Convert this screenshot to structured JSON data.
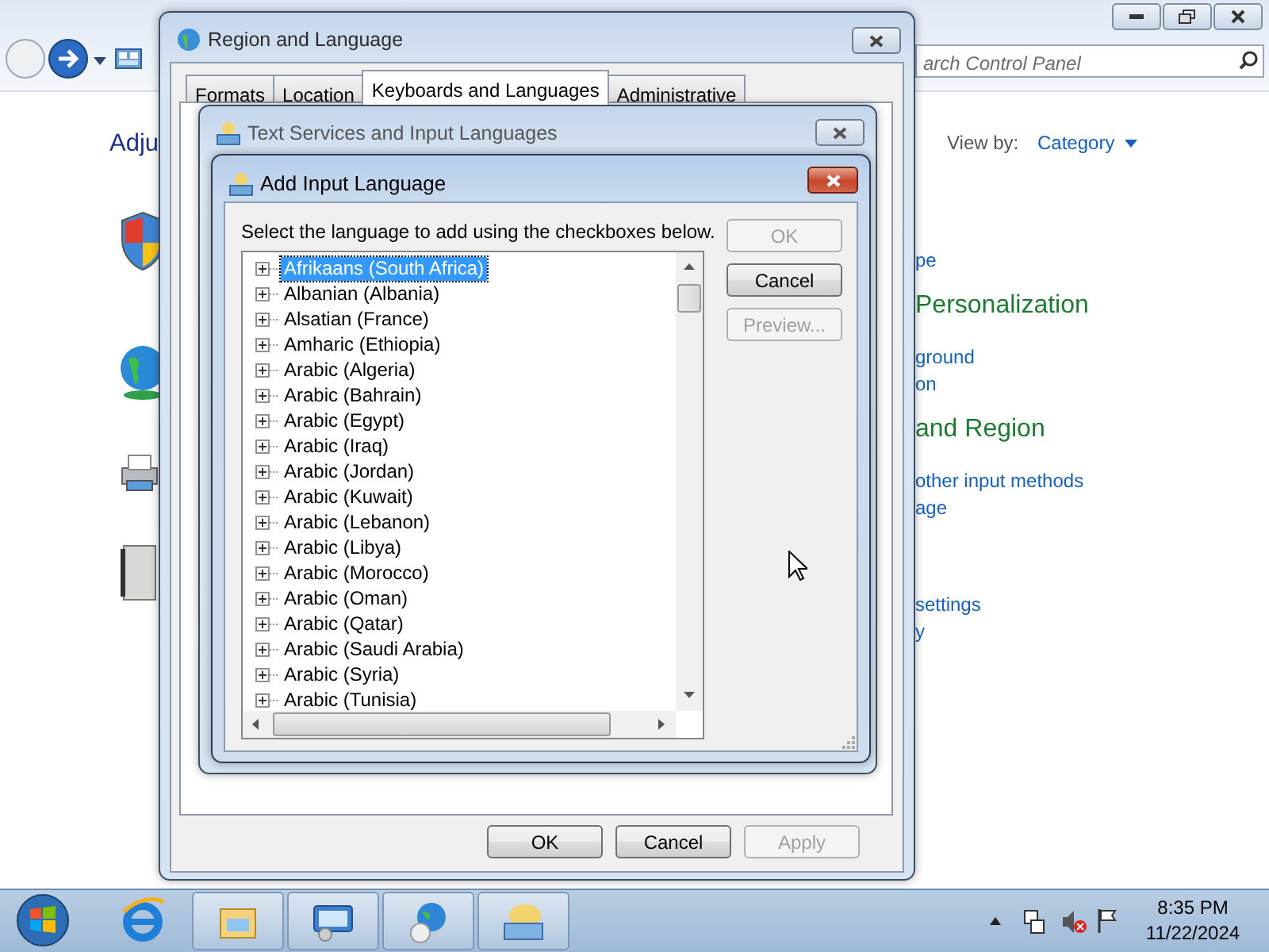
{
  "control_panel": {
    "search": {
      "placeholder": "arch Control Panel"
    },
    "heading": "Adju",
    "view_by_label": "View by:",
    "view_by_value": "Category",
    "groups": [
      {
        "links": [
          "pe"
        ]
      },
      {
        "title": "Personalization",
        "links": [
          "ground",
          "on"
        ]
      },
      {
        "title": "and Region",
        "links": [
          "other input methods",
          "age"
        ]
      },
      {
        "links": [
          "settings",
          "y"
        ]
      }
    ]
  },
  "region_dialog": {
    "title": "Region and Language",
    "tabs": [
      {
        "label": "Formats",
        "selected": false
      },
      {
        "label": "Location",
        "selected": false
      },
      {
        "label": "Keyboards and Languages",
        "selected": true
      },
      {
        "label": "Administrative",
        "selected": false
      }
    ],
    "buttons": [
      {
        "label": "OK",
        "disabled": false
      },
      {
        "label": "Cancel",
        "disabled": false
      },
      {
        "label": "Apply",
        "disabled": true
      }
    ]
  },
  "text_services_dialog": {
    "title": "Text Services and Input Languages"
  },
  "add_language_dialog": {
    "title": "Add Input Language",
    "instruction": "Select the language to add using the checkboxes below.",
    "buttons": [
      {
        "label": "OK",
        "disabled": true
      },
      {
        "label": "Cancel",
        "disabled": false
      },
      {
        "label": "Preview...",
        "disabled": true
      }
    ],
    "languages": [
      {
        "label": "Afrikaans (South Africa)",
        "selected": true
      },
      {
        "label": "Albanian (Albania)",
        "selected": false
      },
      {
        "label": "Alsatian (France)",
        "selected": false
      },
      {
        "label": "Amharic (Ethiopia)",
        "selected": false
      },
      {
        "label": "Arabic (Algeria)",
        "selected": false
      },
      {
        "label": "Arabic (Bahrain)",
        "selected": false
      },
      {
        "label": "Arabic (Egypt)",
        "selected": false
      },
      {
        "label": "Arabic (Iraq)",
        "selected": false
      },
      {
        "label": "Arabic (Jordan)",
        "selected": false
      },
      {
        "label": "Arabic (Kuwait)",
        "selected": false
      },
      {
        "label": "Arabic (Lebanon)",
        "selected": false
      },
      {
        "label": "Arabic (Libya)",
        "selected": false
      },
      {
        "label": "Arabic (Morocco)",
        "selected": false
      },
      {
        "label": "Arabic (Oman)",
        "selected": false
      },
      {
        "label": "Arabic (Qatar)",
        "selected": false
      },
      {
        "label": "Arabic (Saudi Arabia)",
        "selected": false
      },
      {
        "label": "Arabic (Syria)",
        "selected": false
      },
      {
        "label": "Arabic (Tunisia)",
        "selected": false
      }
    ]
  },
  "taskbar": {
    "clock": {
      "time": "8:35 PM",
      "date": "11/22/2024"
    }
  }
}
